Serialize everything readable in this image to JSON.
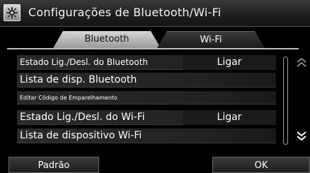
{
  "header": {
    "title": "Configurações de Bluetooth/Wi-Fi",
    "icon": "settings-gear-icon"
  },
  "tabs": [
    {
      "label": "Bluetooth",
      "active": true
    },
    {
      "label": "Wi-Fi",
      "active": false
    }
  ],
  "settings": [
    {
      "label": "Estado Lig./Desl. do Bluetooth",
      "value": "Ligar"
    },
    {
      "label": "Lista de disp. Bluetooth",
      "value": ""
    },
    {
      "label": "Editar Código de Emparelhamento",
      "value": ""
    },
    {
      "label": "Estado Lig./Desl. do Wi-Fi",
      "value": "Ligar"
    },
    {
      "label": "Lista de dispositivo Wi-Fi",
      "value": ""
    }
  ],
  "footer": {
    "default_label": "Padrão",
    "ok_label": "OK"
  },
  "colors": {
    "background": "#000000",
    "active_tab": "#c8c8c8",
    "row": "#2a2a2a"
  }
}
